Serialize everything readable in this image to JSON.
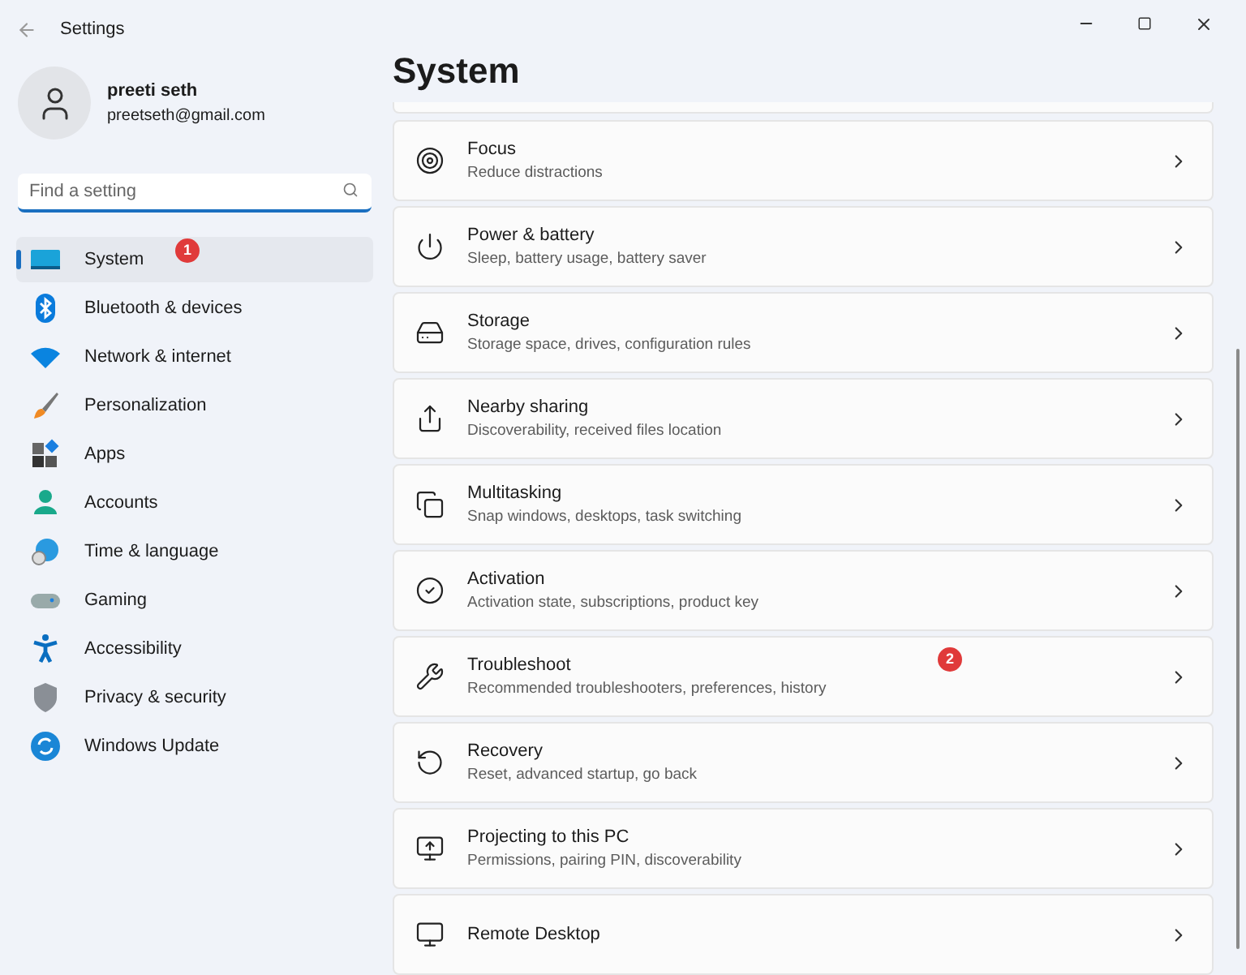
{
  "window": {
    "title": "Settings"
  },
  "user": {
    "name": "preeti seth",
    "email": "preetseth@gmail.com"
  },
  "search": {
    "placeholder": "Find a setting"
  },
  "sidebar": {
    "items": [
      {
        "label": "System",
        "selected": true,
        "badge": "1"
      },
      {
        "label": "Bluetooth & devices",
        "selected": false
      },
      {
        "label": "Network & internet",
        "selected": false
      },
      {
        "label": "Personalization",
        "selected": false
      },
      {
        "label": "Apps",
        "selected": false
      },
      {
        "label": "Accounts",
        "selected": false
      },
      {
        "label": "Time & language",
        "selected": false
      },
      {
        "label": "Gaming",
        "selected": false
      },
      {
        "label": "Accessibility",
        "selected": false
      },
      {
        "label": "Privacy & security",
        "selected": false
      },
      {
        "label": "Windows Update",
        "selected": false
      }
    ]
  },
  "page": {
    "title": "System",
    "items": [
      {
        "title": "Focus",
        "subtitle": "Reduce distractions"
      },
      {
        "title": "Power & battery",
        "subtitle": "Sleep, battery usage, battery saver"
      },
      {
        "title": "Storage",
        "subtitle": "Storage space, drives, configuration rules"
      },
      {
        "title": "Nearby sharing",
        "subtitle": "Discoverability, received files location"
      },
      {
        "title": "Multitasking",
        "subtitle": "Snap windows, desktops, task switching"
      },
      {
        "title": "Activation",
        "subtitle": "Activation state, subscriptions, product key"
      },
      {
        "title": "Troubleshoot",
        "subtitle": "Recommended troubleshooters, preferences, history",
        "badge": "2"
      },
      {
        "title": "Recovery",
        "subtitle": "Reset, advanced startup, go back"
      },
      {
        "title": "Projecting to this PC",
        "subtitle": "Permissions, pairing PIN, discoverability"
      },
      {
        "title": "Remote Desktop"
      }
    ]
  }
}
